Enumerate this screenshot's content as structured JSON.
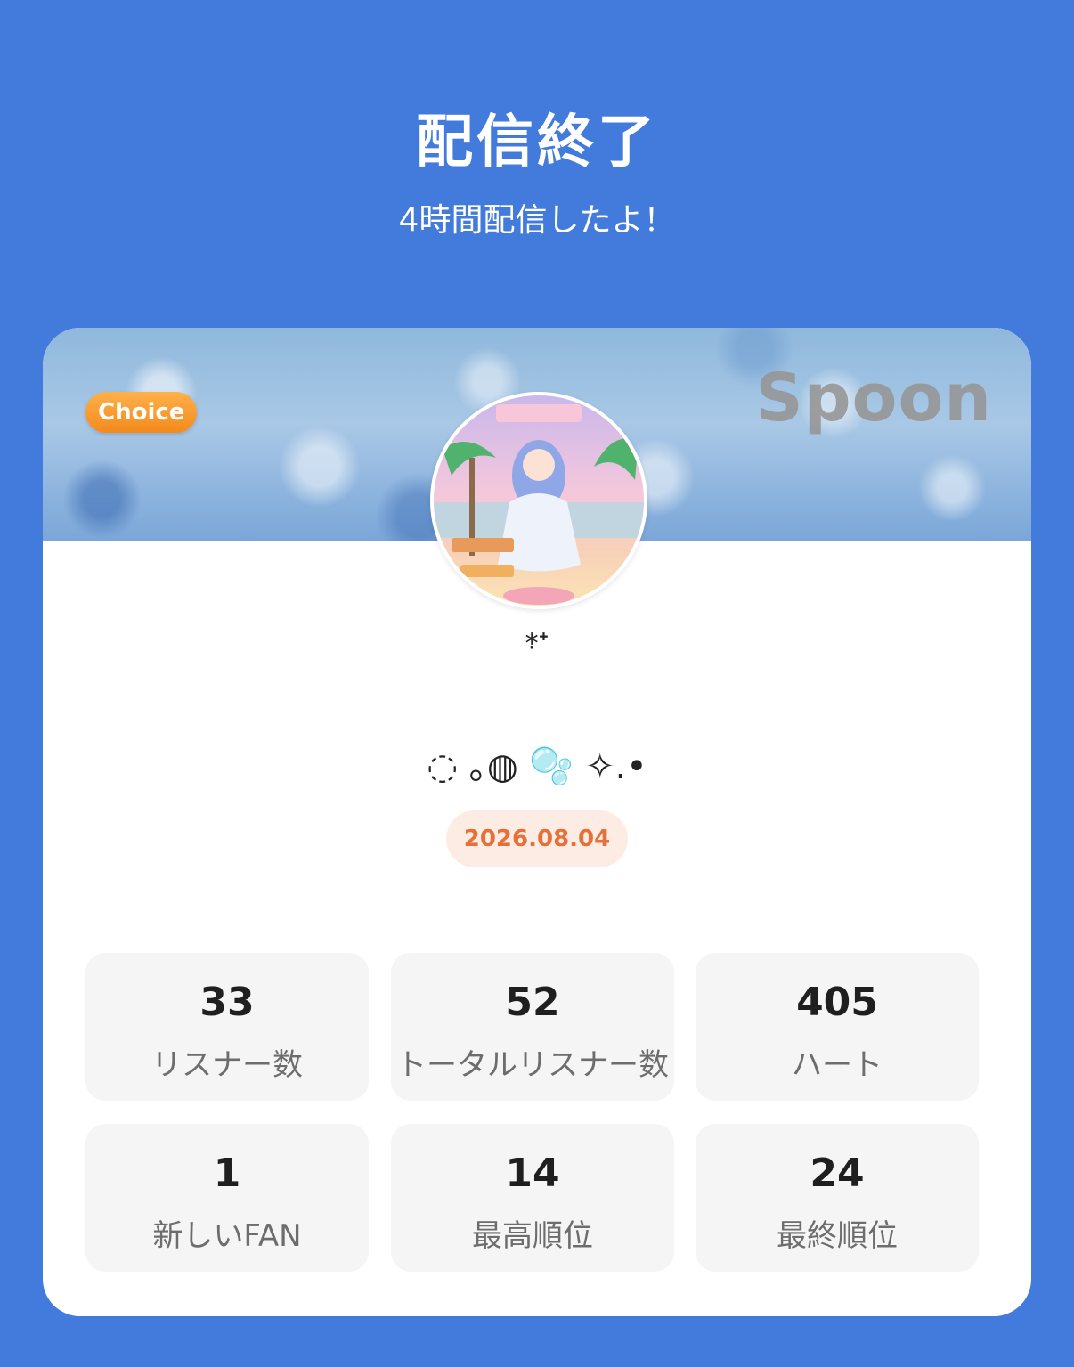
{
  "header": {
    "title": "配信終了",
    "subtitle": "4時間配信したよ！"
  },
  "card": {
    "choice_badge": "Choice",
    "brand_logo": "Spoon",
    "user_name": "⁎̣˖",
    "decoration_text": "◌ ｡◍ 🫧 ✧.•",
    "date": "2026.08.04"
  },
  "stats": [
    {
      "value": "33",
      "label": "リスナー数"
    },
    {
      "value": "52",
      "label": "トータルリスナー数"
    },
    {
      "value": "405",
      "label": "ハート"
    },
    {
      "value": "1",
      "label": "新しいFAN"
    },
    {
      "value": "14",
      "label": "最高順位"
    },
    {
      "value": "24",
      "label": "最終順位"
    }
  ],
  "colors": {
    "background": "#427bdb",
    "date_text": "#e5703a",
    "date_bg": "#fdece4",
    "choice_badge": "#f38a1d"
  }
}
